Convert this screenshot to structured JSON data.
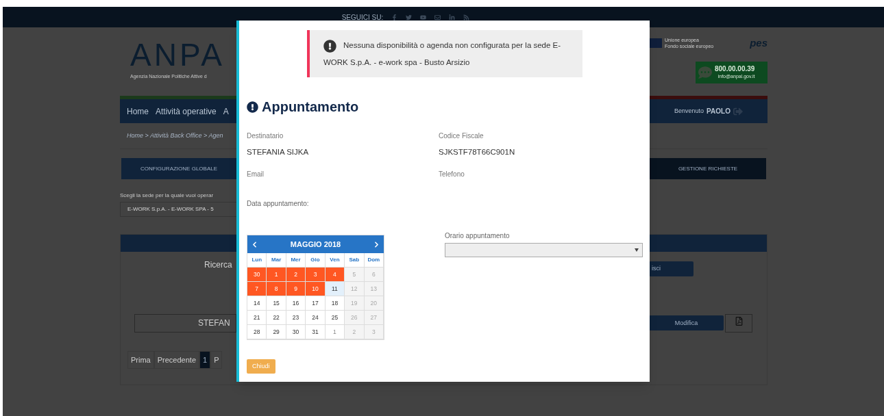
{
  "top_bar": {
    "label": "SEGUICI SU:"
  },
  "header": {
    "logo_text": "ANPA",
    "logo_subtitle": "Agenzia Nazionale Politiche Attive d",
    "eu_lines": [
      "Unione europea",
      "Fondo sociale europeo"
    ],
    "pes": "pes",
    "phone": "800.00.00.39",
    "email": "info@anpal.gov.it"
  },
  "nav": {
    "items": [
      {
        "label": "Home"
      },
      {
        "label": "Attività operative"
      },
      {
        "label": "A"
      }
    ],
    "welcome": "Benvenuto",
    "user": "PAOLO"
  },
  "breadcrumb": "Home > Attività Back Office > Agen",
  "tabs": [
    {
      "label": "CONFIGURAZIONE GLOBALE"
    },
    {
      "label": "GESTIONE RICHIESTE"
    }
  ],
  "sede": {
    "label": "Scegli la sede per la quale vuoi operar",
    "value": "E-WORK S.p.A. - E-WORK SPA - 5"
  },
  "panel": {
    "search_label": "Ricerca",
    "search_button": "isci",
    "row_name": "STEFAN",
    "edit_button": "Modifica",
    "pagination": [
      {
        "label": "Prima",
        "selected": false
      },
      {
        "label": "Precedente",
        "selected": false
      },
      {
        "label": "1",
        "selected": true
      },
      {
        "label": "P",
        "selected": false
      }
    ]
  },
  "modal": {
    "alert": [
      "Nessuna disponibilità o agenda non configurata per la sede E-",
      "WORK S.p.A. - e-work spa - Busto Arsizio"
    ],
    "title": "Appuntamento",
    "fields": [
      {
        "label": "Destinatario",
        "value": "STEFANIA SIJKA"
      },
      {
        "label": "Codice Fiscale",
        "value": "SJKSTF78T66C901N"
      },
      {
        "label": "Email"
      },
      {
        "label": "Telefono"
      }
    ],
    "date_label": "Data appuntamento:",
    "calendar": {
      "title": "MAGGIO 2018",
      "weekdays": [
        "Lun",
        "Mar",
        "Mer",
        "Gio",
        "Ven",
        "Sab",
        "Dom"
      ],
      "weeks": [
        [
          {
            "day": "30",
            "kind": "marked"
          },
          {
            "day": "1",
            "kind": "marked"
          },
          {
            "day": "2",
            "kind": "marked"
          },
          {
            "day": "3",
            "kind": "marked"
          },
          {
            "day": "4",
            "kind": "marked"
          },
          {
            "day": "5",
            "kind": "disabled"
          },
          {
            "day": "6",
            "kind": "disabled"
          }
        ],
        [
          {
            "day": "7",
            "kind": "marked"
          },
          {
            "day": "8",
            "kind": "marked"
          },
          {
            "day": "9",
            "kind": "marked"
          },
          {
            "day": "10",
            "kind": "marked"
          },
          {
            "day": "11",
            "kind": "today"
          },
          {
            "day": "12",
            "kind": "disabled"
          },
          {
            "day": "13",
            "kind": "disabled"
          }
        ],
        [
          {
            "day": "14",
            "kind": "normal"
          },
          {
            "day": "15",
            "kind": "normal"
          },
          {
            "day": "16",
            "kind": "normal"
          },
          {
            "day": "17",
            "kind": "normal"
          },
          {
            "day": "18",
            "kind": "normal"
          },
          {
            "day": "19",
            "kind": "disabled"
          },
          {
            "day": "20",
            "kind": "disabled"
          }
        ],
        [
          {
            "day": "21",
            "kind": "normal"
          },
          {
            "day": "22",
            "kind": "normal"
          },
          {
            "day": "23",
            "kind": "normal"
          },
          {
            "day": "24",
            "kind": "normal"
          },
          {
            "day": "25",
            "kind": "normal"
          },
          {
            "day": "26",
            "kind": "disabled"
          },
          {
            "day": "27",
            "kind": "disabled"
          }
        ],
        [
          {
            "day": "28",
            "kind": "normal"
          },
          {
            "day": "29",
            "kind": "normal"
          },
          {
            "day": "30",
            "kind": "normal"
          },
          {
            "day": "31",
            "kind": "normal"
          },
          {
            "day": "1",
            "kind": "other"
          },
          {
            "day": "2",
            "kind": "disabled"
          },
          {
            "day": "3",
            "kind": "disabled"
          }
        ]
      ]
    },
    "time_label": "Orario appuntamento",
    "close_button": "Chiudi"
  }
}
